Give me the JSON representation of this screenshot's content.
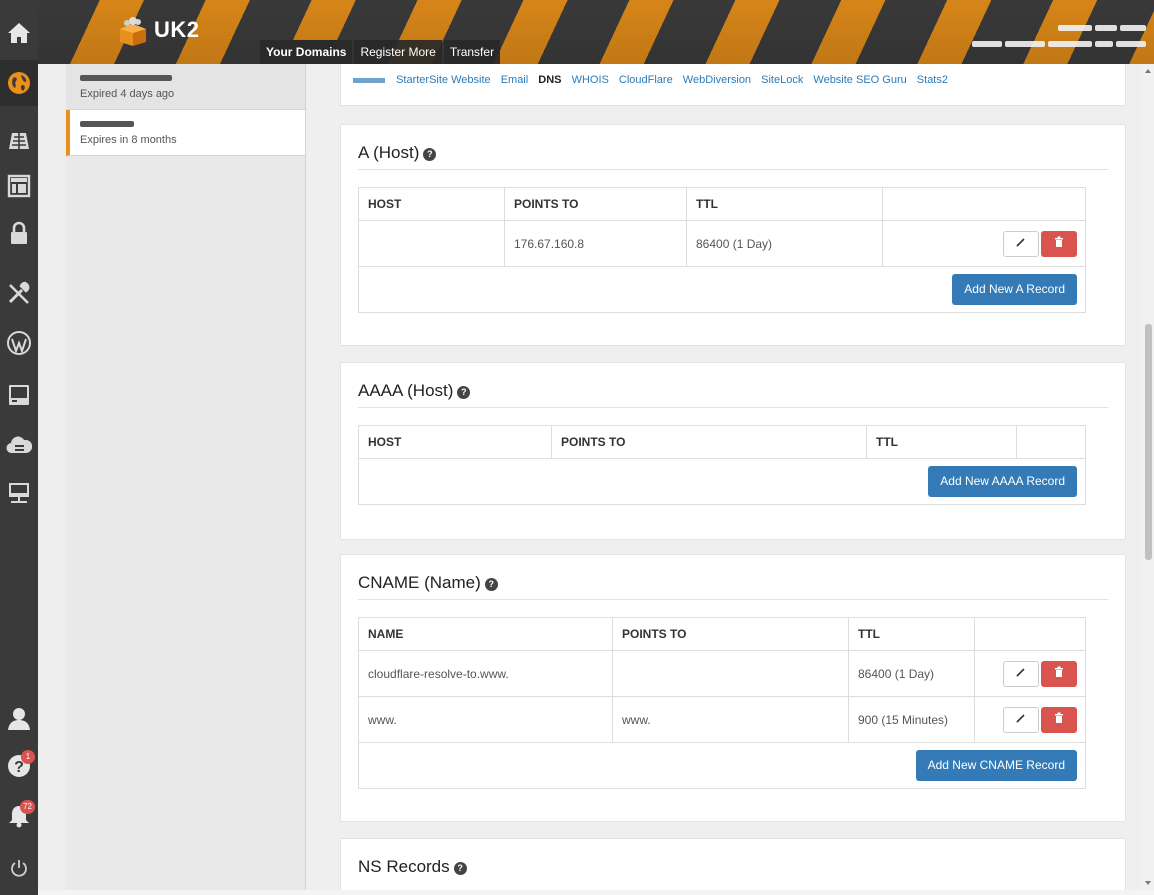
{
  "header": {
    "brand": "UK2",
    "nav_tabs": [
      {
        "label": "Your Domains",
        "active": true
      },
      {
        "label": "Register More",
        "active": false
      },
      {
        "label": "Transfer",
        "active": false
      }
    ]
  },
  "sidebar_icons": [
    "home-icon",
    "globe-icon",
    "hosting-icon",
    "website-builder-icon",
    "lock-icon",
    "tools-icon",
    "wordpress-icon",
    "server-icon",
    "cloud-server-icon",
    "dedicated-server-icon",
    "user-icon",
    "help-icon",
    "bell-icon",
    "power-icon"
  ],
  "badges": {
    "help": "1",
    "notifications": "72"
  },
  "domains": [
    {
      "status": "Expired 4 days ago",
      "selected": false
    },
    {
      "status": "Expires in 8 months",
      "selected": true
    }
  ],
  "service_tabs": [
    {
      "label": "StarterSite Website",
      "active": false
    },
    {
      "label": "Email",
      "active": false
    },
    {
      "label": "DNS",
      "active": true
    },
    {
      "label": "WHOIS",
      "active": false
    },
    {
      "label": "CloudFlare",
      "active": false
    },
    {
      "label": "WebDiversion",
      "active": false
    },
    {
      "label": "SiteLock",
      "active": false
    },
    {
      "label": "Website SEO Guru",
      "active": false
    },
    {
      "label": "Stats2",
      "active": false
    }
  ],
  "a_record": {
    "title": "A (Host)",
    "col_host": "HOST",
    "col_points": "POINTS TO",
    "col_ttl": "TTL",
    "rows": [
      {
        "host": "",
        "points": "176.67.160.8",
        "ttl": "86400 (1 Day)"
      }
    ],
    "add_label": "Add New A Record"
  },
  "aaaa_record": {
    "title": "AAAA (Host)",
    "col_host": "HOST",
    "col_points": "POINTS TO",
    "col_ttl": "TTL",
    "add_label": "Add New AAAA Record"
  },
  "cname_record": {
    "title": "CNAME (Name)",
    "col_name": "NAME",
    "col_points": "POINTS TO",
    "col_ttl": "TTL",
    "rows": [
      {
        "name": "cloudflare-resolve-to.www.",
        "points": "",
        "ttl": "86400 (1 Day)"
      },
      {
        "name": "www.",
        "points": "www.",
        "ttl": "900 (15 Minutes)"
      }
    ],
    "add_label": "Add New CNAME Record"
  },
  "ns_record": {
    "title": "NS Records"
  },
  "colors": {
    "accent": "#e8901b",
    "primary": "#337ab7",
    "danger": "#d9534f",
    "rail": "#3a3a3a"
  }
}
